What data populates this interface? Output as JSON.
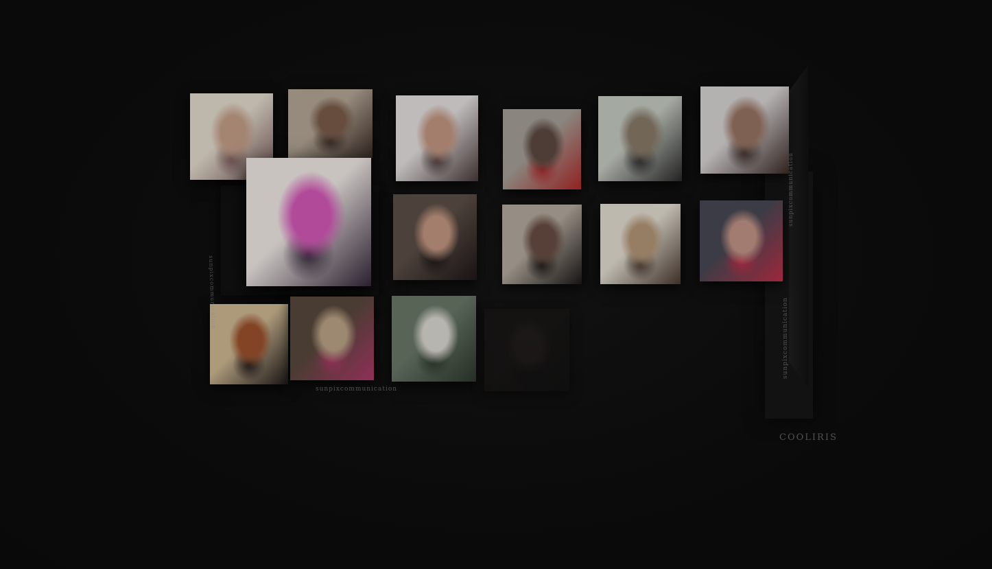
{
  "gallery": {
    "watermark_text": "sunpixcommunication",
    "brand_mark": "COOLIRIS"
  },
  "tiles": [
    {
      "id": "r1c1",
      "desc": "photo-swimwear-back",
      "colors": [
        "#e8e0d2",
        "#c9a38c",
        "#7a5a5a"
      ]
    },
    {
      "id": "r1c2",
      "desc": "photo-woman-seated-chair",
      "colors": [
        "#b8aa98",
        "#7d5f4c",
        "#3a2b26"
      ]
    },
    {
      "id": "r1c3",
      "desc": "photo-headphones-portrait",
      "colors": [
        "#e9e4e4",
        "#c79a84",
        "#4a3a3a"
      ]
    },
    {
      "id": "r1c4",
      "desc": "photo-woman-with-drink-can",
      "colors": [
        "#a9a39a",
        "#5e4b43",
        "#b12a2a"
      ]
    },
    {
      "id": "r1c5",
      "desc": "photo-woman-lying-floor",
      "colors": [
        "#c9cfc6",
        "#8c7d6b",
        "#2b2a2a"
      ]
    },
    {
      "id": "r1c6",
      "desc": "photo-portrait-windowlight",
      "colors": [
        "#dcd8d8",
        "#9c7766",
        "#3a2a26"
      ]
    },
    {
      "id": "r2c1",
      "desc": "photo-pink-dress-bed",
      "colors": [
        "#c9c3c0",
        "#b24a9a",
        "#2b2030"
      ]
    },
    {
      "id": "r2c2",
      "desc": "photo-portrait-dark-hair",
      "colors": [
        "#5e5048",
        "#c79a84",
        "#1e1818"
      ]
    },
    {
      "id": "r2c3",
      "desc": "photo-sunglasses-drinking",
      "colors": [
        "#b8aea2",
        "#6a4f44",
        "#1c1816"
      ]
    },
    {
      "id": "r2c4",
      "desc": "photo-sunglasses-blonde",
      "colors": [
        "#e8e2d6",
        "#b89a7a",
        "#4a3a30"
      ]
    },
    {
      "id": "r2c5",
      "desc": "photo-red-lips-portrait",
      "colors": [
        "#4a4a56",
        "#c7988a",
        "#c0304a"
      ]
    },
    {
      "id": "r3c1",
      "desc": "photo-curtain-black-dress",
      "colors": [
        "#d2bc96",
        "#a0532e",
        "#201a1a"
      ]
    },
    {
      "id": "r3c2",
      "desc": "photo-lamp-sofa",
      "colors": [
        "#5a4a3e",
        "#c0a88a",
        "#b03a6a"
      ]
    },
    {
      "id": "r3c3",
      "desc": "photo-white-dress-garden",
      "colors": [
        "#6b7a6a",
        "#e0ddd6",
        "#2e3a2e"
      ]
    },
    {
      "id": "r3c4",
      "desc": "photo-faded-portrait",
      "colors": [
        "#1f1c1a",
        "#2c2624",
        "#151313"
      ]
    }
  ]
}
